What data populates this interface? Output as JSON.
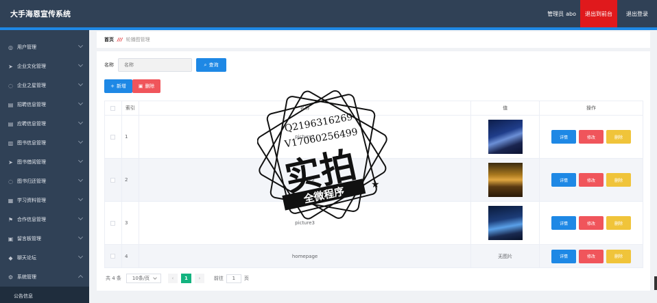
{
  "header": {
    "title": "大手海恩宣传系统",
    "admin_label": "管理员",
    "admin_name": "abo",
    "front_button": "退出到前台",
    "logout_button": "退出登录"
  },
  "sidebar": {
    "items": [
      {
        "label": "用户管理",
        "icon": "user-icon"
      },
      {
        "label": "企业文化管理",
        "icon": "send-icon"
      },
      {
        "label": "企业之星管理",
        "icon": "circle-icon"
      },
      {
        "label": "招聘信息管理",
        "icon": "doc-icon"
      },
      {
        "label": "应聘信息管理",
        "icon": "doc-icon"
      },
      {
        "label": "图书信息管理",
        "icon": "book-icon"
      },
      {
        "label": "图书借阅管理",
        "icon": "send-icon"
      },
      {
        "label": "图书归还管理",
        "icon": "circle-icon"
      },
      {
        "label": "学习资料管理",
        "icon": "folder-icon"
      },
      {
        "label": "合作信息管理",
        "icon": "flag-icon"
      },
      {
        "label": "留言板管理",
        "icon": "message-icon"
      },
      {
        "label": "聊天论坛",
        "icon": "chat-icon"
      },
      {
        "label": "系统管理",
        "icon": "gear-icon"
      }
    ],
    "sub_item": "公告信息"
  },
  "breadcrumb": {
    "home": "首页",
    "separator": "///",
    "current": "轮播图管理"
  },
  "search": {
    "label": "名称",
    "placeholder": "名称",
    "button": "查询"
  },
  "actions": {
    "add": "新增",
    "delete": "删除"
  },
  "table": {
    "headers": {
      "index": "索引",
      "name": "名称",
      "value": "值",
      "ops": "操作"
    },
    "rows": [
      {
        "index": "1",
        "name": "picture1",
        "value": "",
        "has_image": true
      },
      {
        "index": "2",
        "name": "picture2",
        "value": "",
        "has_image": true
      },
      {
        "index": "3",
        "name": "picture3",
        "value": "",
        "has_image": true
      },
      {
        "index": "4",
        "name": "homepage",
        "value": "无图片",
        "has_image": false
      }
    ],
    "op_labels": {
      "detail": "详情",
      "edit": "修改",
      "delete": "删除"
    }
  },
  "pager": {
    "total": "共 4 条",
    "size": "10条/页",
    "current_page": "1",
    "goto_label": "前往",
    "goto_value": "1",
    "page_suffix": "页"
  },
  "watermark": {
    "qq": "Q2196316269",
    "vx": "V17060256499",
    "big": "实拍",
    "banner": "全微程序"
  },
  "colors": {
    "header_bg": "#304156",
    "accent_red": "#e0191c",
    "primary_blue": "#1e88e5",
    "danger": "#f0555b",
    "warning": "#f0c43a",
    "pager_active": "#13b37f"
  }
}
